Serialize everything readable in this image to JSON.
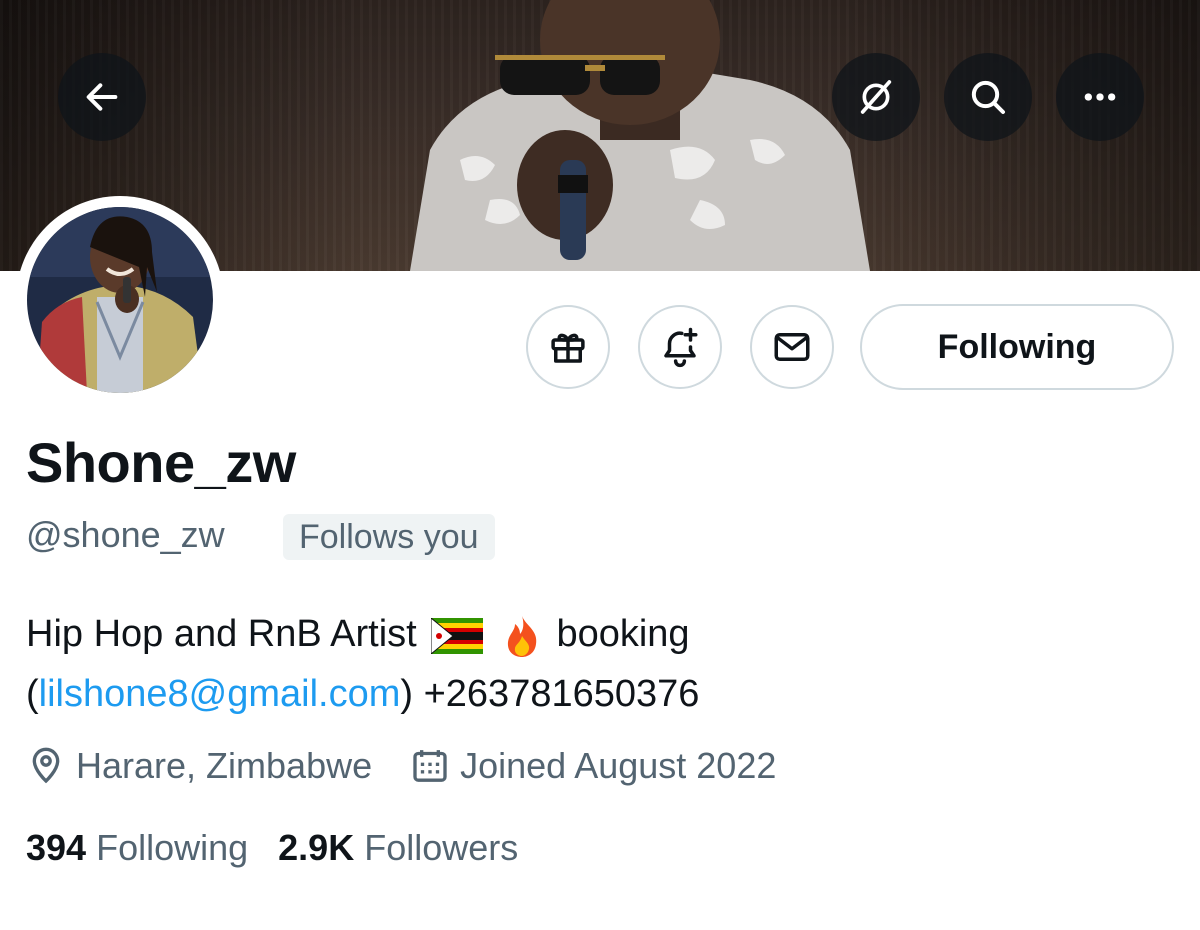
{
  "header": {
    "back_icon": "arrow-left-icon",
    "grok_icon": "grok-icon",
    "search_icon": "search-icon",
    "more_icon": "more-horizontal-icon"
  },
  "actions": {
    "gift_icon": "gift-icon",
    "notify_icon": "bell-plus-icon",
    "message_icon": "envelope-icon",
    "following_label": "Following"
  },
  "profile": {
    "display_name": "Shone_zw",
    "handle": "@shone_zw",
    "follows_you_badge": "Follows you",
    "bio": {
      "text_before_flag": "Hip Hop and RnB Artist",
      "flag_emoji": "zimbabwe-flag",
      "fire_emoji": "fire",
      "text_after_emoji": "booking",
      "paren_open": "(",
      "email_link": "lilshone8@gmail.com",
      "paren_close_and_phone": ") +263781650376"
    },
    "location": "Harare, Zimbabwe",
    "joined": "Joined August 2022"
  },
  "stats": {
    "following_count": "394",
    "following_label": "Following",
    "followers_count": "2.9K",
    "followers_label": "Followers"
  },
  "colors": {
    "link": "#1d9bf0",
    "secondary_text": "#536471",
    "primary_text": "#0f1419",
    "border": "#cfd9de",
    "badge_bg": "#eff3f4"
  }
}
